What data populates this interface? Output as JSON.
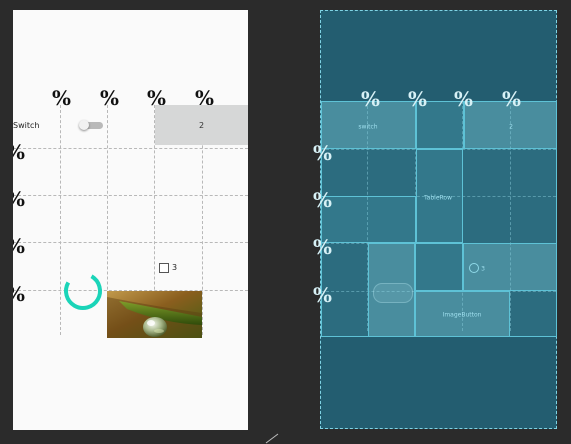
{
  "preview": {
    "percent_headers": [
      "%",
      "%",
      "%",
      "%"
    ],
    "row_markers": [
      "%",
      "%",
      "%",
      "%"
    ],
    "switch": {
      "label": "Switch",
      "checked": false
    },
    "button": {
      "label": "2"
    },
    "checkbox": {
      "label": "3",
      "checked": false
    },
    "spinner": {
      "color": "#1ad4b8"
    },
    "image": {
      "name": "water-droplet-on-leaf"
    }
  },
  "blueprint": {
    "percent_headers": [
      "%",
      "%",
      "%",
      "%"
    ],
    "row_markers": [
      "%",
      "%",
      "%",
      "%"
    ],
    "switch_label": "switch",
    "button_label": "2",
    "center_label": "TableRow",
    "checkbox_label": "3",
    "imagebutton_label": "ImageButton"
  },
  "colors": {
    "workspace_bg": "#2b2b2b",
    "preview_bg": "#fafafa",
    "blueprint_bg": "#235d70",
    "blueprint_border": "#5ec2d6",
    "accent_spinner": "#1ad4b8"
  }
}
